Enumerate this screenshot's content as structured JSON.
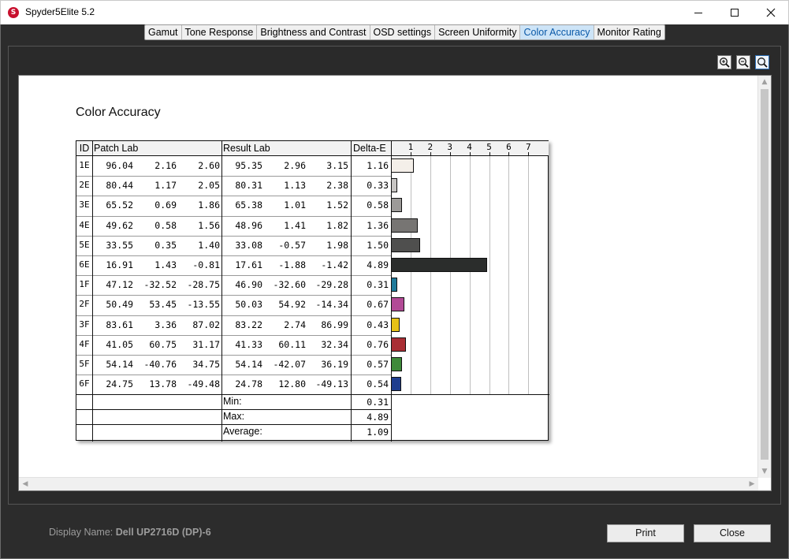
{
  "window": {
    "title": "Spyder5Elite 5.2",
    "icon_letter": "S"
  },
  "tabs": [
    {
      "label": "Gamut",
      "active": false
    },
    {
      "label": "Tone Response",
      "active": false
    },
    {
      "label": "Brightness and Contrast",
      "active": false
    },
    {
      "label": "OSD settings",
      "active": false
    },
    {
      "label": "Screen Uniformity",
      "active": false
    },
    {
      "label": "Color Accuracy",
      "active": true
    },
    {
      "label": "Monitor Rating",
      "active": false
    }
  ],
  "report": {
    "title": "Color Accuracy",
    "headers": {
      "id": "ID",
      "patch": "Patch Lab",
      "result": "Result Lab",
      "delta": "Delta-E"
    },
    "axis_ticks": [
      "1",
      "2",
      "3",
      "4",
      "5",
      "6",
      "7"
    ],
    "rows": [
      {
        "id": "1E",
        "patch": [
          "96.04",
          "2.16",
          "2.60"
        ],
        "result": [
          "95.35",
          "2.96",
          "3.15"
        ],
        "delta": "1.16",
        "color": "#f4efe9"
      },
      {
        "id": "2E",
        "patch": [
          "80.44",
          "1.17",
          "2.05"
        ],
        "result": [
          "80.31",
          "1.13",
          "2.38"
        ],
        "delta": "0.33",
        "color": "#c7c5c3"
      },
      {
        "id": "3E",
        "patch": [
          "65.52",
          "0.69",
          "1.86"
        ],
        "result": [
          "65.38",
          "1.01",
          "1.52"
        ],
        "delta": "0.58",
        "color": "#9c9a98"
      },
      {
        "id": "4E",
        "patch": [
          "49.62",
          "0.58",
          "1.56"
        ],
        "result": [
          "48.96",
          "1.41",
          "1.82"
        ],
        "delta": "1.36",
        "color": "#777573"
      },
      {
        "id": "5E",
        "patch": [
          "33.55",
          "0.35",
          "1.40"
        ],
        "result": [
          "33.08",
          "-0.57",
          "1.98"
        ],
        "delta": "1.50",
        "color": "#4f4f4e"
      },
      {
        "id": "6E",
        "patch": [
          "16.91",
          "1.43",
          "-0.81"
        ],
        "result": [
          "17.61",
          "-1.88",
          "-1.42"
        ],
        "delta": "4.89",
        "color": "#2b2d2c"
      },
      {
        "id": "1F",
        "patch": [
          "47.12",
          "-32.52",
          "-28.75"
        ],
        "result": [
          "46.90",
          "-32.60",
          "-29.28"
        ],
        "delta": "0.31",
        "color": "#1f7a9a"
      },
      {
        "id": "2F",
        "patch": [
          "50.49",
          "53.45",
          "-13.55"
        ],
        "result": [
          "50.03",
          "54.92",
          "-14.34"
        ],
        "delta": "0.67",
        "color": "#b24a96"
      },
      {
        "id": "3F",
        "patch": [
          "83.61",
          "3.36",
          "87.02"
        ],
        "result": [
          "83.22",
          "2.74",
          "86.99"
        ],
        "delta": "0.43",
        "color": "#e6c117"
      },
      {
        "id": "4F",
        "patch": [
          "41.05",
          "60.75",
          "31.17"
        ],
        "result": [
          "41.33",
          "60.11",
          "32.34"
        ],
        "delta": "0.76",
        "color": "#a92e34"
      },
      {
        "id": "5F",
        "patch": [
          "54.14",
          "-40.76",
          "34.75"
        ],
        "result": [
          "54.14",
          "-42.07",
          "36.19"
        ],
        "delta": "0.57",
        "color": "#3f8a3a"
      },
      {
        "id": "6F",
        "patch": [
          "24.75",
          "13.78",
          "-49.48"
        ],
        "result": [
          "24.78",
          "12.80",
          "-49.13"
        ],
        "delta": "0.54",
        "color": "#1e3d8e"
      }
    ],
    "summary": [
      {
        "label": "Min:",
        "value": "0.31"
      },
      {
        "label": "Max:",
        "value": "4.89"
      },
      {
        "label": "Average:",
        "value": "1.09"
      }
    ]
  },
  "footer": {
    "display_label": "Display Name:",
    "display_value": "Dell UP2716D (DP)-6",
    "print_label": "Print",
    "close_label": "Close"
  },
  "icons": {
    "zoom_in": "zoom-in-icon",
    "zoom_out": "zoom-out-icon",
    "zoom_fit": "zoom-fit-icon"
  }
}
